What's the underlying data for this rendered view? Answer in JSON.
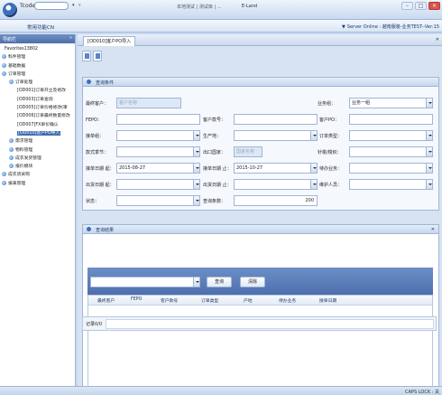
{
  "titlebar": {
    "tcode_label": "Tcode",
    "window_title": "本地测试 | 测试库 | ...",
    "app_name": "E-Land",
    "minimize": "–",
    "maximize": "□",
    "close": "×"
  },
  "menubar": {
    "common_functions": "常用功能CN",
    "server_status": "Server Online : 越南服装-业务TEST--Ver:15"
  },
  "sidebar": {
    "title": "导航栏",
    "pin": "»",
    "items": [
      {
        "label": "Favorites13802"
      },
      {
        "label": "料件管理"
      },
      {
        "label": "基础数据"
      },
      {
        "label": "订单管理"
      },
      {
        "label": "订单处理"
      },
      {
        "label": "[OD001]订单开立及修改"
      },
      {
        "label": "[OD003]订单查询"
      },
      {
        "label": "[OD005]订单价格修改(审"
      },
      {
        "label": "[OD006]订单最终数量修改"
      },
      {
        "label": "[OD007]FX单价确认"
      },
      {
        "label": "[OD010]客户PO导入"
      },
      {
        "label": "需求管理"
      },
      {
        "label": "物料管理"
      },
      {
        "label": "成衣发货管理"
      },
      {
        "label": "报价模块"
      },
      {
        "label": "成衣货采购"
      },
      {
        "label": "报表管理"
      }
    ]
  },
  "tab": {
    "label": "[OD010]客户PO导入",
    "close": "✕"
  },
  "query_panel": {
    "title": "查询条件",
    "fields": {
      "final_customer": {
        "label": "最终客户：",
        "value": "客户名称"
      },
      "business_group": {
        "label": "业务组：",
        "value": "业务一组"
      },
      "fepo": {
        "label": "FEPO：",
        "value": ""
      },
      "customer_no": {
        "label": "客户款号：",
        "value": ""
      },
      "customer_po": {
        "label": "客户PO：",
        "value": ""
      },
      "order_group": {
        "label": "接单组：",
        "value": ""
      },
      "producer": {
        "label": "生产地：",
        "value": ""
      },
      "order_type": {
        "label": "订单类型：",
        "value": ""
      },
      "season": {
        "label": "款式季节：",
        "value": ""
      },
      "export_country": {
        "label": "出口国家：",
        "value": "国家名称"
      },
      "fabric": {
        "label": "针梭/梭织：",
        "value": ""
      },
      "order_date_from": {
        "label": "接单日期 起：",
        "value": "2015-08-27"
      },
      "order_date_to": {
        "label": "接单日期 止：",
        "value": "2015-10-27"
      },
      "merchandiser": {
        "label": "待办业务：",
        "value": ""
      },
      "ship_date_from": {
        "label": "出货日期 起：",
        "value": ""
      },
      "ship_date_to": {
        "label": "出货日期 止：",
        "value": ""
      },
      "maintainer": {
        "label": "维护人员：",
        "value": ""
      },
      "status": {
        "label": "状态：",
        "value": ""
      },
      "query_count": {
        "label": "查询条数：",
        "value": "200"
      }
    }
  },
  "result_panel": {
    "title": "查询结果",
    "close": "✕",
    "search_button": "查询",
    "clear_button": "清除",
    "columns": [
      "最终客户",
      "FEPO",
      "客户款号",
      "订单类型",
      "产地",
      "待办业务",
      "接单日期"
    ],
    "pager": "记录0/0"
  },
  "statusbar": {
    "caps_lock": "CAPS LOCK : 关"
  }
}
